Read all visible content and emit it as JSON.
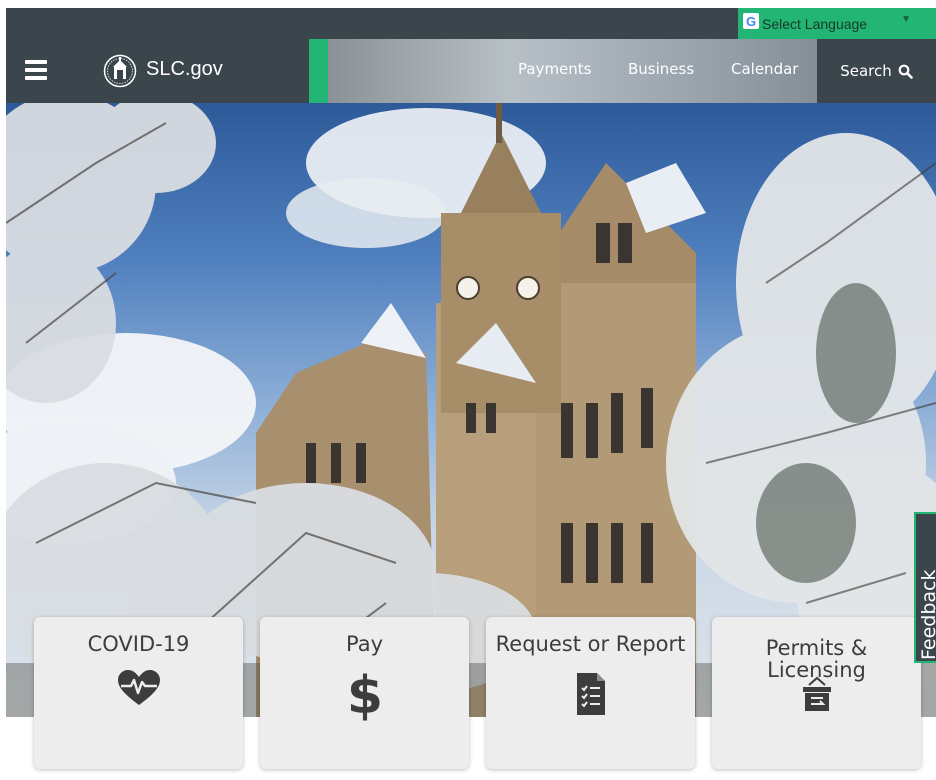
{
  "language_bar": {
    "label": "Select Language",
    "arrow": "▼"
  },
  "header": {
    "logo_text_main": "SLC",
    "logo_text_tld": ".gov",
    "nav_links": [
      {
        "label": "Payments"
      },
      {
        "label": "Business"
      },
      {
        "label": "Calendar"
      }
    ],
    "search_label": "Search"
  },
  "cards": [
    {
      "label": "COVID-19",
      "icon": "heartbeat-icon"
    },
    {
      "label": "Pay",
      "icon": "dollar-icon"
    },
    {
      "label": "Request or Report",
      "icon": "checklist-document-icon"
    },
    {
      "label_line1": "Permits &",
      "label_line2": "Licensing",
      "icon": "permit-box-icon"
    }
  ],
  "feedback_label": "Feedback",
  "colors": {
    "accent_green": "#22b573",
    "header_dark": "#3b454c",
    "card_bg": "#ededed",
    "icon_dark": "#3d3d3d"
  }
}
